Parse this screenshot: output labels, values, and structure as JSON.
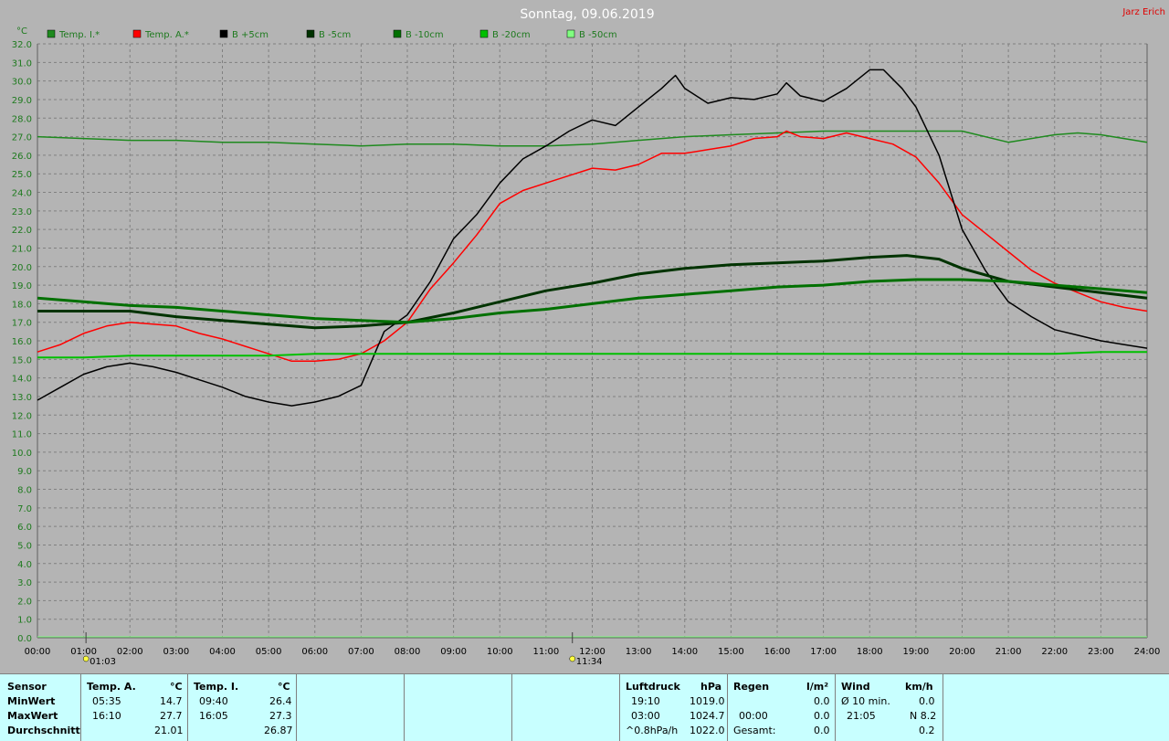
{
  "header": {
    "title": "Sonntag, 09.06.2019",
    "author": "Jarz Erich",
    "y_unit": "°C"
  },
  "legend": [
    {
      "label": "Temp. I.*",
      "color": "#1e8a1e"
    },
    {
      "label": "Temp. A.*",
      "color": "#ff0000"
    },
    {
      "label": "B +5cm",
      "color": "#000000"
    },
    {
      "label": "B -5cm",
      "color": "#003300"
    },
    {
      "label": "B -10cm",
      "color": "#007000"
    },
    {
      "label": "B -20cm",
      "color": "#00c000"
    },
    {
      "label": "B -50cm",
      "color": "#80ff80"
    }
  ],
  "markers": [
    {
      "label": "01:03",
      "x": 1.05
    },
    {
      "label": "11:34",
      "x": 11.57
    }
  ],
  "chart_data": {
    "type": "line",
    "title": "Sonntag, 09.06.2019",
    "xlabel": "",
    "ylabel": "°C",
    "xlim": [
      0,
      24
    ],
    "ylim": [
      0,
      32
    ],
    "grid": true,
    "legend_position": "top",
    "x_ticks": [
      "00:00",
      "01:00",
      "02:00",
      "03:00",
      "04:00",
      "05:00",
      "06:00",
      "07:00",
      "08:00",
      "09:00",
      "10:00",
      "11:00",
      "12:00",
      "13:00",
      "14:00",
      "15:00",
      "16:00",
      "17:00",
      "18:00",
      "19:00",
      "20:00",
      "21:00",
      "22:00",
      "23:00",
      "24:00"
    ],
    "y_ticks": [
      "0.0",
      "1.0",
      "2.0",
      "3.0",
      "4.0",
      "5.0",
      "6.0",
      "7.0",
      "8.0",
      "9.0",
      "10.0",
      "11.0",
      "12.0",
      "13.0",
      "14.0",
      "15.0",
      "16.0",
      "17.0",
      "18.0",
      "19.0",
      "20.0",
      "21.0",
      "22.0",
      "23.0",
      "24.0",
      "25.0",
      "26.0",
      "27.0",
      "28.0",
      "29.0",
      "30.0",
      "31.0",
      "32.0"
    ],
    "series": [
      {
        "name": "Temp. I.*",
        "color": "#1e8a1e",
        "width": 1.5,
        "x": [
          0,
          1,
          2,
          3,
          4,
          5,
          6,
          7,
          8,
          9,
          10,
          11,
          12,
          13,
          14,
          15,
          16,
          17,
          18,
          19,
          20,
          21,
          22,
          22.5,
          23,
          24
        ],
        "y": [
          27.0,
          26.9,
          26.8,
          26.8,
          26.7,
          26.7,
          26.6,
          26.5,
          26.6,
          26.6,
          26.5,
          26.5,
          26.6,
          26.8,
          27.0,
          27.1,
          27.2,
          27.3,
          27.3,
          27.3,
          27.3,
          26.7,
          27.1,
          27.2,
          27.1,
          26.7
        ]
      },
      {
        "name": "Temp. A.*",
        "color": "#ff0000",
        "width": 1.5,
        "x": [
          0,
          0.5,
          1,
          1.5,
          2,
          2.5,
          3,
          3.5,
          4,
          4.5,
          5,
          5.5,
          6,
          6.5,
          7,
          7.5,
          8,
          8.5,
          9,
          9.5,
          10,
          10.5,
          11,
          11.5,
          12,
          12.5,
          13,
          13.5,
          14,
          14.5,
          15,
          15.5,
          16,
          16.2,
          16.5,
          17,
          17.5,
          18,
          18.5,
          19,
          19.5,
          20,
          20.5,
          21,
          21.5,
          22,
          22.5,
          23,
          23.5,
          24
        ],
        "y": [
          15.4,
          15.8,
          16.4,
          16.8,
          17.0,
          16.9,
          16.8,
          16.4,
          16.1,
          15.7,
          15.3,
          14.9,
          14.9,
          15.0,
          15.3,
          16.0,
          17.0,
          18.8,
          20.2,
          21.7,
          23.4,
          24.1,
          24.5,
          24.9,
          25.3,
          25.2,
          25.5,
          26.1,
          26.1,
          26.3,
          26.5,
          26.9,
          27.0,
          27.3,
          27.0,
          26.9,
          27.2,
          26.9,
          26.6,
          25.9,
          24.5,
          22.8,
          21.8,
          20.8,
          19.8,
          19.1,
          18.6,
          18.1,
          17.8,
          17.6
        ]
      },
      {
        "name": "B +5cm",
        "color": "#000000",
        "width": 1.5,
        "x": [
          0,
          0.5,
          1,
          1.5,
          2,
          2.5,
          3,
          3.5,
          4,
          4.5,
          5,
          5.5,
          6,
          6.5,
          7,
          7.5,
          8,
          8.5,
          9,
          9.5,
          10,
          10.5,
          11,
          11.5,
          12,
          12.5,
          13,
          13.5,
          13.8,
          14,
          14.5,
          15,
          15.5,
          16,
          16.2,
          16.5,
          17,
          17.5,
          18,
          18.3,
          18.7,
          19,
          19.5,
          20,
          20.5,
          21,
          21.5,
          22,
          22.5,
          23,
          23.5,
          24
        ],
        "y": [
          12.8,
          13.5,
          14.2,
          14.6,
          14.8,
          14.6,
          14.3,
          13.9,
          13.5,
          13.0,
          12.7,
          12.5,
          12.7,
          13.0,
          13.6,
          16.5,
          17.4,
          19.2,
          21.5,
          22.8,
          24.5,
          25.8,
          26.5,
          27.3,
          27.9,
          27.6,
          28.6,
          29.6,
          30.3,
          29.6,
          28.8,
          29.1,
          29.0,
          29.3,
          29.9,
          29.2,
          28.9,
          29.6,
          30.6,
          30.6,
          29.6,
          28.6,
          26.0,
          22.0,
          19.8,
          18.1,
          17.3,
          16.6,
          16.3,
          16.0,
          15.8,
          15.6
        ]
      },
      {
        "name": "B -5cm",
        "color": "#003300",
        "width": 3,
        "x": [
          0,
          1,
          2,
          3,
          4,
          5,
          6,
          7,
          8,
          9,
          10,
          11,
          12,
          13,
          14,
          15,
          16,
          17,
          18,
          18.8,
          19.5,
          20,
          21,
          22,
          23,
          24
        ],
        "y": [
          17.6,
          17.6,
          17.6,
          17.3,
          17.1,
          16.9,
          16.7,
          16.8,
          17.0,
          17.5,
          18.1,
          18.7,
          19.1,
          19.6,
          19.9,
          20.1,
          20.2,
          20.3,
          20.5,
          20.6,
          20.4,
          19.9,
          19.2,
          18.9,
          18.6,
          18.3
        ]
      },
      {
        "name": "B -10cm",
        "color": "#007000",
        "width": 3,
        "x": [
          0,
          1,
          2,
          3,
          4,
          5,
          6,
          7,
          8,
          9,
          10,
          11,
          12,
          13,
          14,
          15,
          16,
          17,
          18,
          19,
          20,
          21,
          22,
          23,
          24
        ],
        "y": [
          18.3,
          18.1,
          17.9,
          17.8,
          17.6,
          17.4,
          17.2,
          17.1,
          17.0,
          17.2,
          17.5,
          17.7,
          18.0,
          18.3,
          18.5,
          18.7,
          18.9,
          19.0,
          19.2,
          19.3,
          19.3,
          19.2,
          19.0,
          18.8,
          18.6
        ]
      },
      {
        "name": "B -20cm",
        "color": "#00c000",
        "width": 2,
        "x": [
          0,
          1,
          2,
          3,
          4,
          5,
          6,
          7,
          8,
          9,
          10,
          11,
          12,
          13,
          14,
          15,
          16,
          17,
          18,
          19,
          20,
          21,
          22,
          23,
          24
        ],
        "y": [
          15.1,
          15.1,
          15.2,
          15.2,
          15.2,
          15.2,
          15.3,
          15.3,
          15.3,
          15.3,
          15.3,
          15.3,
          15.3,
          15.3,
          15.3,
          15.3,
          15.3,
          15.3,
          15.3,
          15.3,
          15.3,
          15.3,
          15.3,
          15.4,
          15.4
        ]
      },
      {
        "name": "B -50cm",
        "color": "#80ff80",
        "width": 1.5,
        "x": [],
        "y": []
      }
    ]
  },
  "table": {
    "sensor": {
      "header": "Sensor",
      "rows": [
        "MinWert",
        "MaxWert",
        "Durchschnitt"
      ]
    },
    "temp_a": {
      "header": "Temp. A.",
      "unit": "°C",
      "rows": [
        [
          "05:35",
          "14.7"
        ],
        [
          "16:10",
          "27.7"
        ],
        [
          "",
          "21.01"
        ]
      ]
    },
    "temp_i": {
      "header": "Temp. I.",
      "unit": "°C",
      "rows": [
        [
          "09:40",
          "26.4"
        ],
        [
          "16:05",
          "27.3"
        ],
        [
          "",
          "26.87"
        ]
      ]
    },
    "luftdruck": {
      "header": "Luftdruck",
      "unit": "hPa",
      "rows": [
        [
          "19:10",
          "1019.0"
        ],
        [
          "03:00",
          "1024.7"
        ],
        [
          "^0.8hPa/h",
          "1022.0"
        ]
      ]
    },
    "regen": {
      "header": "Regen",
      "unit": "l/m²",
      "rows": [
        [
          "",
          ""
        ],
        [
          "00:00",
          "0.0"
        ],
        [
          "Gesamt:",
          "0.0"
        ]
      ],
      "first_value": "0.0"
    },
    "wind": {
      "header": "Wind",
      "unit": "km/h",
      "rows": [
        [
          "Ø 10 min.",
          "0.0"
        ],
        [
          "21:05",
          "N 8.2"
        ],
        [
          "",
          "0.2"
        ]
      ]
    }
  }
}
